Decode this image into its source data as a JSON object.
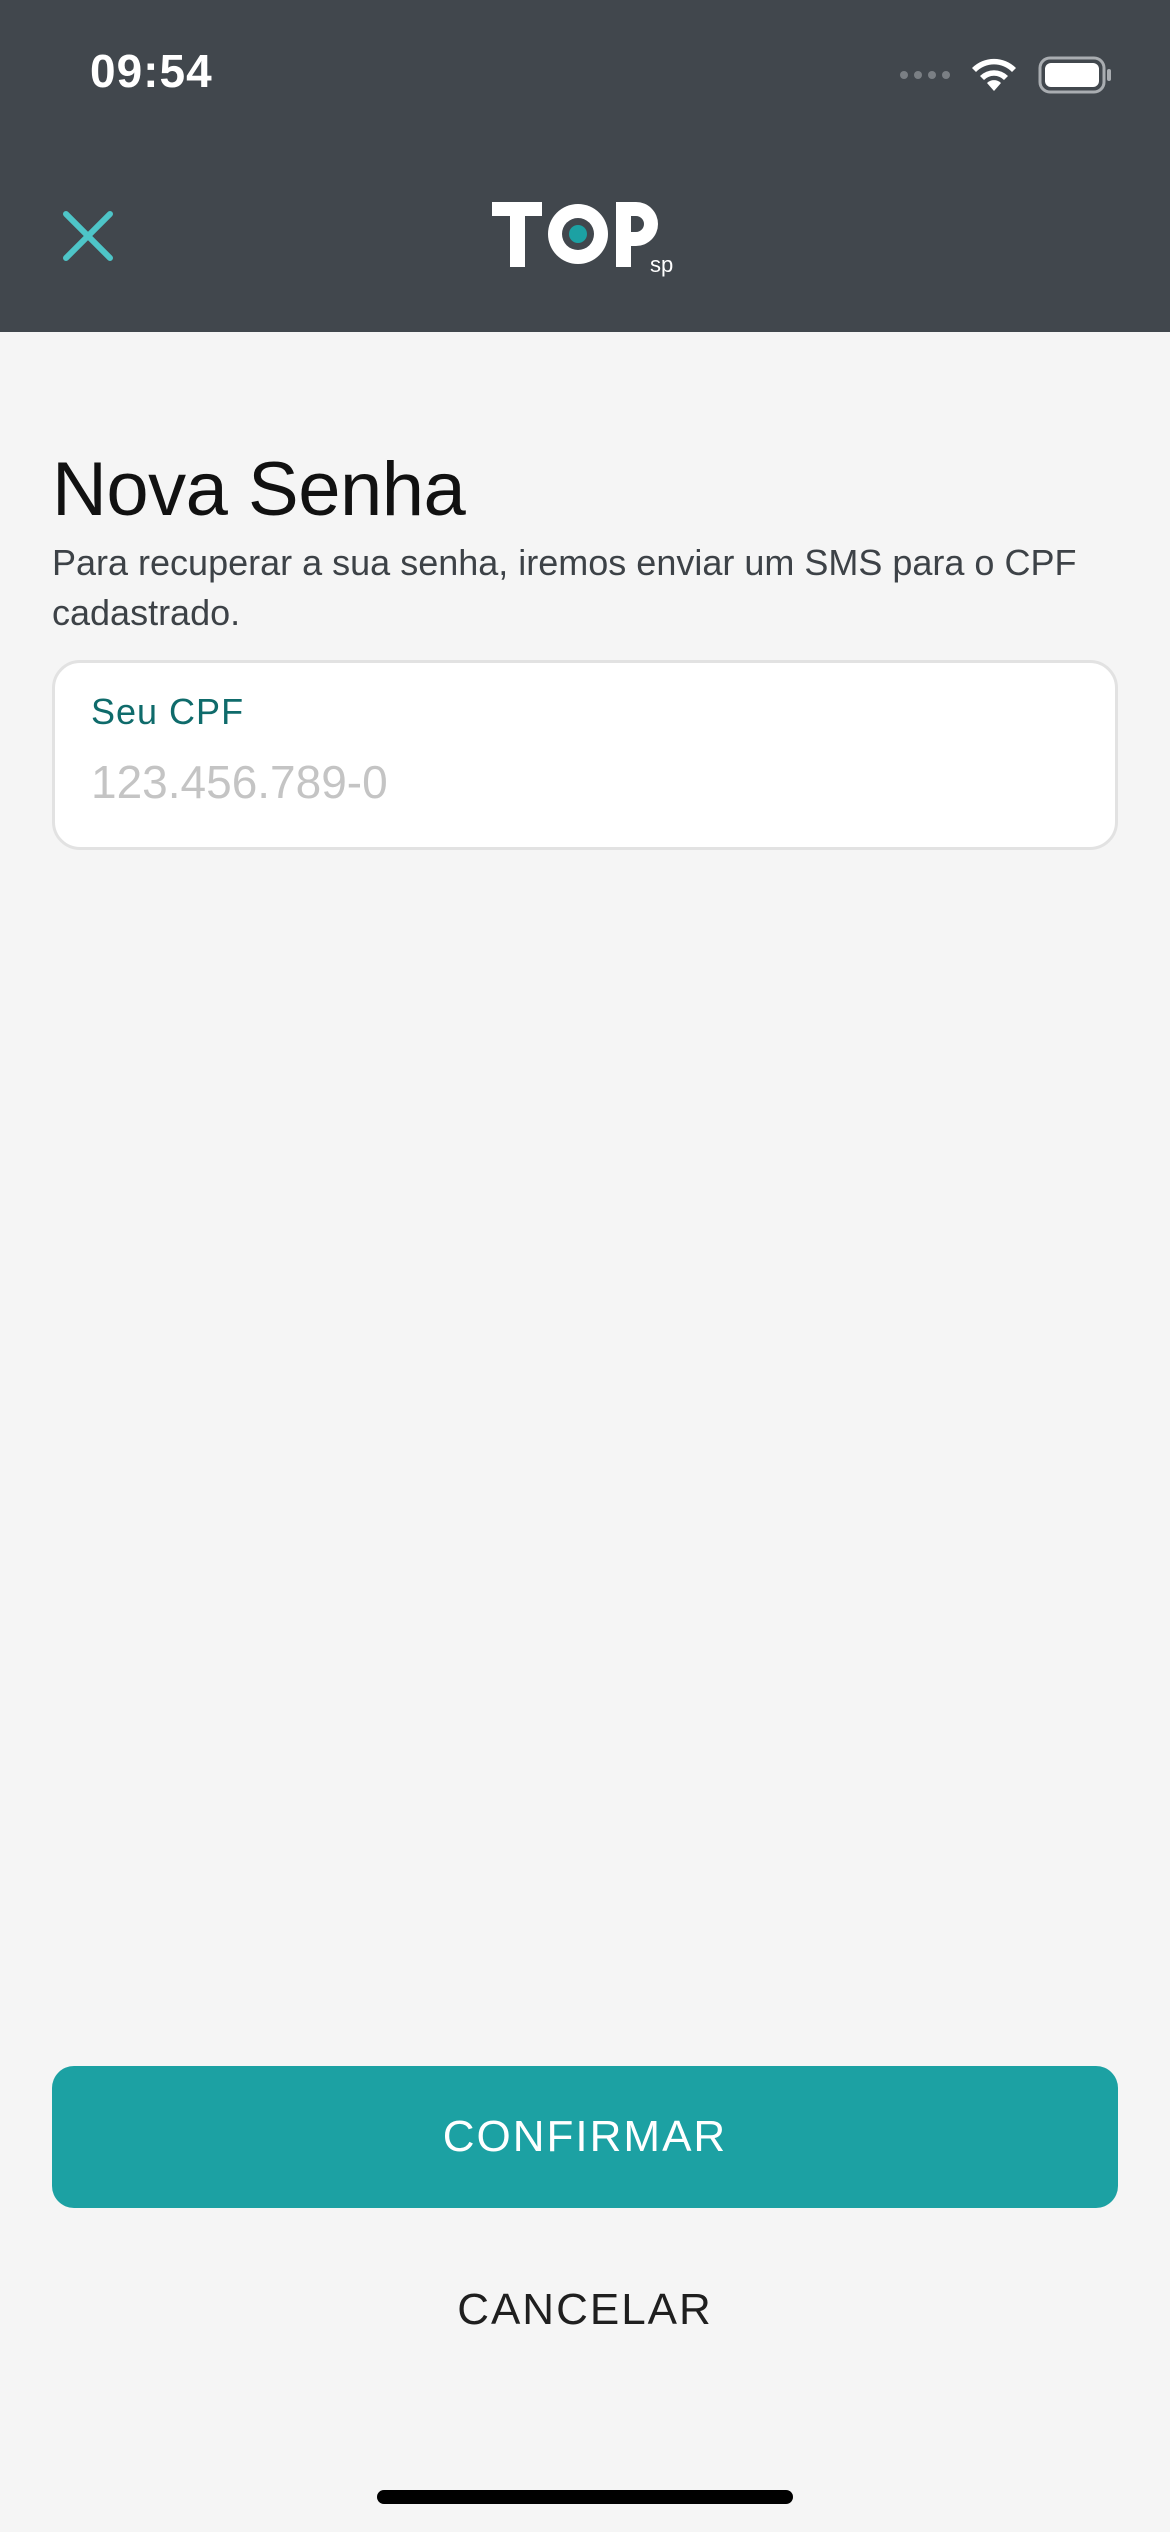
{
  "status_bar": {
    "time": "09:54"
  },
  "header": {
    "close_icon": "close-icon",
    "logo_text": "TOP",
    "logo_sub": "sp"
  },
  "content": {
    "title": "Nova Senha",
    "description": "Para recuperar a sua senha, iremos enviar um SMS para o CPF cadastrado.",
    "cpf_field": {
      "label": "Seu CPF",
      "value": "",
      "placeholder": "123.456.789-0"
    }
  },
  "actions": {
    "confirm_label": "CONFIRMAR",
    "cancel_label": "CANCELAR"
  },
  "colors": {
    "header_bg": "#41474d",
    "accent": "#1ca1a3",
    "close_icon": "#4ec5c8",
    "label": "#0f6b6b",
    "background": "#f5f5f5"
  }
}
